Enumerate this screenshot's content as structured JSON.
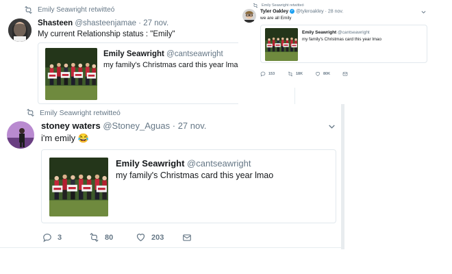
{
  "tweet1": {
    "retweeted_by": "Emily Seawright retwitteó",
    "name": "Shasteen",
    "handle": "@shasteenjamae",
    "time": "27 nov.",
    "text": "My current Relationship status : \"Emily\"",
    "quote": {
      "name": "Emily Seawright",
      "handle": "@cantseawright",
      "text": "my family's Christmas card this year lmao"
    }
  },
  "tweet2": {
    "retweeted_by": "Emily Seawright retwitteó",
    "name": "Tyler Oakley",
    "handle": "@tyleroakley",
    "time": "28 nov.",
    "text": "we are all Emily",
    "quote": {
      "name": "Emily Seawright",
      "handle": "@cantseawright",
      "text": "my family's Christmas card this year lmao"
    },
    "actions": {
      "replies": "153",
      "retweets": "18K",
      "likes": "80K"
    }
  },
  "tweet3": {
    "retweeted_by": "Emily Seawright retwitteó",
    "name": "stoney waters",
    "handle": "@Stoney_Aguas",
    "time": "27 nov.",
    "text": "i'm emily",
    "emoji": "😂",
    "quote": {
      "name": "Emily Seawright",
      "handle": "@cantseawright",
      "text": "my family's Christmas card this year lmao"
    },
    "actions": {
      "replies": "3",
      "retweets": "80",
      "likes": "203"
    }
  },
  "icons": {
    "retweet": "retweet-icon",
    "reply": "reply-icon",
    "like": "heart-icon",
    "dm": "envelope-icon",
    "more": "chevron-down-icon"
  },
  "colors": {
    "text": "#14171a",
    "muted": "#657786",
    "border": "#e1e8ed",
    "verified": "#1da1f2"
  }
}
